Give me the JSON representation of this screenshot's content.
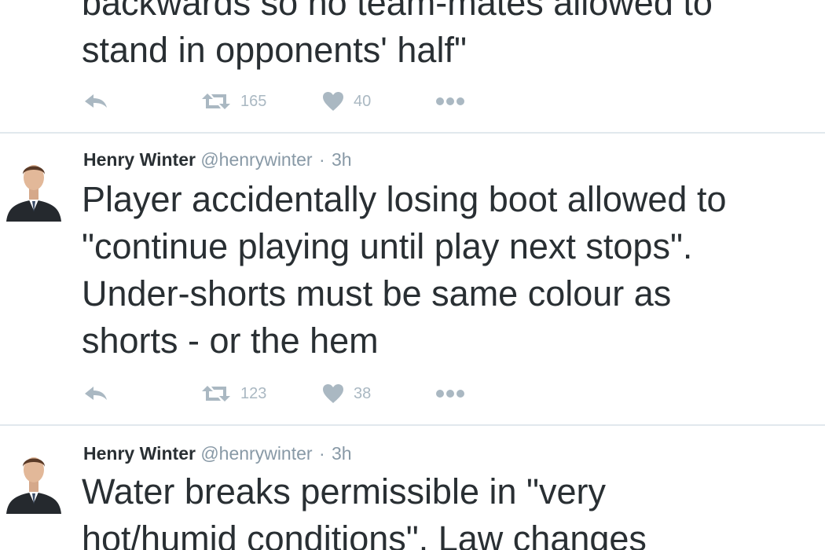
{
  "tweets": [
    {
      "text": "backwards so no team-mates allowed to\nstand in opponents' half\"",
      "retweets": "165",
      "likes": "40"
    },
    {
      "name": "Henry Winter",
      "handle": "@henrywinter",
      "separator": "·",
      "time": "3h",
      "text": "Player accidentally losing boot allowed to\n\"continue playing until play next stops\".\nUnder-shorts must be same colour as\nshorts - or the hem",
      "retweets": "123",
      "likes": "38"
    },
    {
      "name": "Henry Winter",
      "handle": "@henrywinter",
      "separator": "·",
      "time": "3h",
      "text": "Water breaks permissible in \"very\nhot/humid conditions\". Law changes"
    }
  ],
  "icons": {
    "reply": "reply-icon",
    "retweet": "retweet-icon",
    "like": "heart-icon",
    "more": "more-dots-icon"
  },
  "colors": {
    "text": "#292f33",
    "muted": "#8899a6",
    "action": "#aab8c2",
    "divider": "#e1e8ed"
  }
}
